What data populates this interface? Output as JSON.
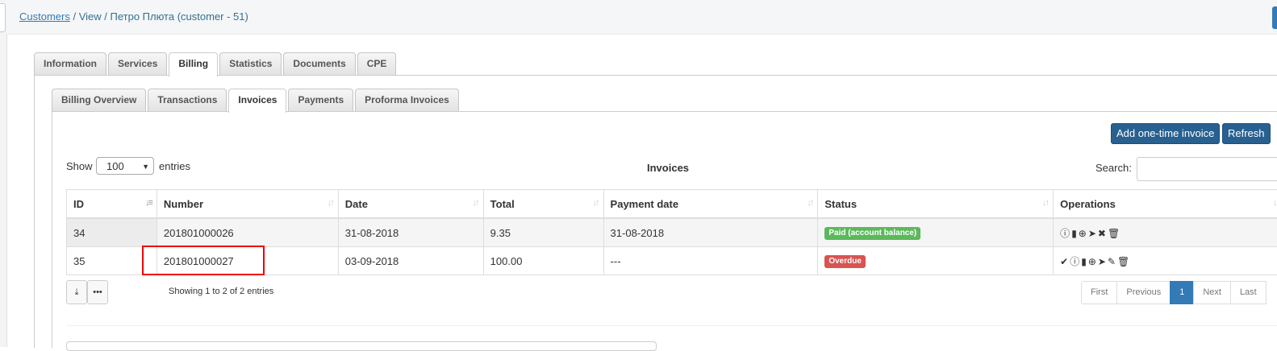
{
  "breadcrumb": {
    "root": "Customers",
    "sep1": " / ",
    "view": "View",
    "sep2": " / ",
    "customer": "Петро Плюта (customer - 51)"
  },
  "main_tabs": [
    "Information",
    "Services",
    "Billing",
    "Statistics",
    "Documents",
    "CPE"
  ],
  "main_active": "Billing",
  "billing_tabs": [
    "Billing Overview",
    "Transactions",
    "Invoices",
    "Payments",
    "Proforma Invoices"
  ],
  "billing_active": "Invoices",
  "actions": {
    "add": "Add one-time invoice",
    "refresh": "Refresh"
  },
  "length": {
    "show": "Show",
    "value": "100",
    "entries": "entries"
  },
  "table": {
    "title": "Invoices",
    "search_label": "Search:",
    "columns": [
      "ID",
      "Number",
      "Date",
      "Total",
      "Payment date",
      "Status",
      "Operations"
    ],
    "rows": [
      {
        "id": "34",
        "number": "201801000026",
        "date": "31-08-2018",
        "total": "9.35",
        "payment_date": "31-08-2018",
        "status": "Paid (account balance)",
        "status_color": "#5cb85c",
        "ops": [
          "info-icon",
          "file-icon",
          "download-icon",
          "send-icon",
          "close-icon",
          "trash-icon"
        ]
      },
      {
        "id": "35",
        "number": "201801000027",
        "date": "03-09-2018",
        "total": "100.00",
        "payment_date": "---",
        "status": "Overdue",
        "status_color": "#d9534f",
        "ops": [
          "check-icon",
          "info-icon",
          "file-icon",
          "download-icon",
          "send-icon",
          "edit-icon",
          "trash-icon"
        ]
      }
    ],
    "info": "Showing 1 to 2 of 2 entries"
  },
  "pagination": {
    "first": "First",
    "previous": "Previous",
    "page": "1",
    "next": "Next",
    "last": "Last"
  },
  "colors": {
    "link": "#337ab7",
    "primary": "#286090",
    "paid": "#5cb85c",
    "overdue": "#d9534f",
    "highlight": "#ee0000"
  }
}
